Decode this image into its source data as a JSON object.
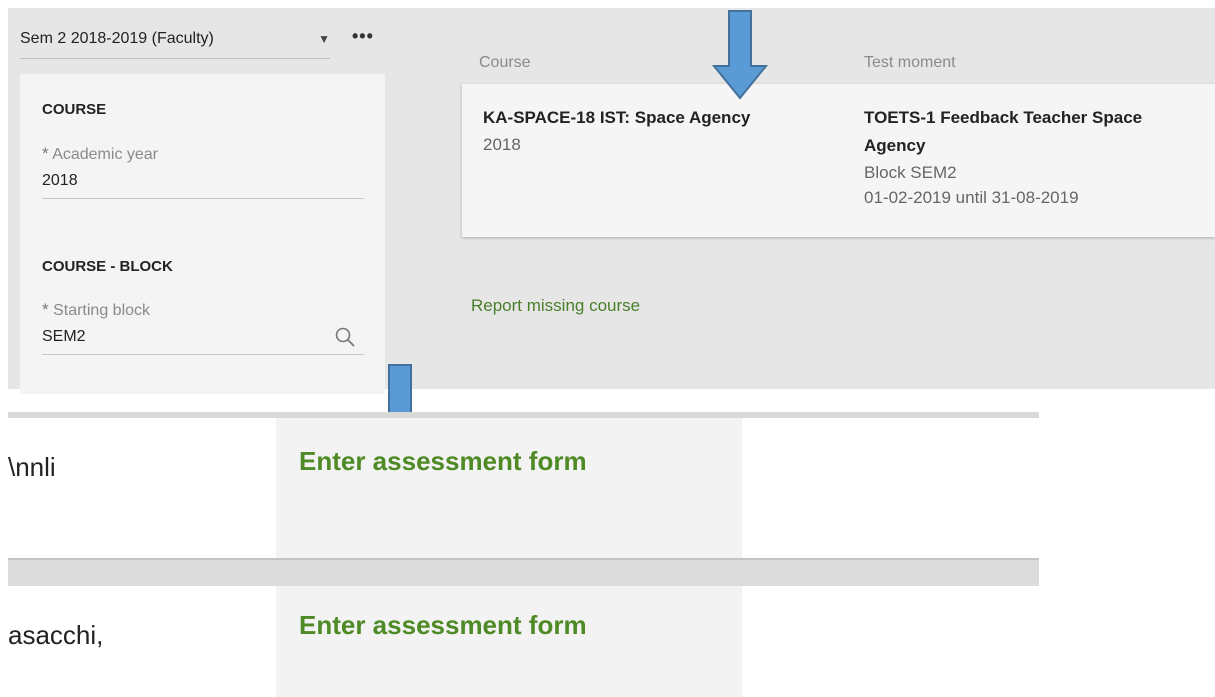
{
  "header": {
    "term_select": "Sem 2 2018-2019 (Faculty)",
    "more_label": "•••"
  },
  "filters": {
    "course_section": "COURSE",
    "academic_year_label": "Academic year",
    "academic_year_value": "2018",
    "block_section": "COURSE - BLOCK",
    "starting_block_label": "Starting block",
    "starting_block_value": "SEM2",
    "required_mark": "*"
  },
  "results": {
    "col_course": "Course",
    "col_test_moment": "Test moment",
    "course_title": "KA-SPACE-18  IST: Space Agency",
    "course_year": "2018",
    "test_title_line1": "TOETS-1  Feedback Teacher Space",
    "test_title_line2": "Agency",
    "test_block": "Block SEM2",
    "test_period": "01-02-2019 until 31-08-2019",
    "report_missing": "Report missing course"
  },
  "rows": [
    {
      "name": "\\nnli",
      "action": "Enter assessment form"
    },
    {
      "name": "asacchi,",
      "action": "Enter assessment form"
    }
  ],
  "colors": {
    "link_green": "#4e8a25",
    "arrow_blue": "#5b9bd5",
    "arrow_outline": "#41719c"
  },
  "icons": [
    "dropdown-caret-icon",
    "more-icon",
    "search-icon",
    "down-arrow-icon"
  ]
}
